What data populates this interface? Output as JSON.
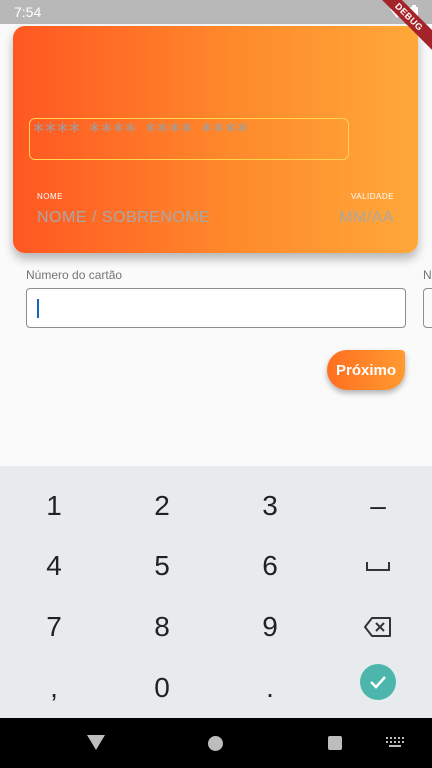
{
  "status_bar": {
    "time": "7:54",
    "debug_label": "DEBUG"
  },
  "card": {
    "number_placeholder": "**** **** **** ****",
    "name_caption": "NOME",
    "name_placeholder": "NOME / SOBRENOME",
    "validity_caption": "VALIDADE",
    "validity_placeholder": "MM/AA",
    "colors": {
      "gradient_start": "#ff5722",
      "gradient_end": "#ffa83a",
      "number_border": "#ffd54f"
    }
  },
  "form": {
    "card_number_label": "Número do cartão",
    "card_number_value": "",
    "next_field_label": "N",
    "next_button_label": "Próximo"
  },
  "keyboard": {
    "rows": [
      [
        "1",
        "2",
        "3",
        "–"
      ],
      [
        "4",
        "5",
        "6",
        "space-icon"
      ],
      [
        "7",
        "8",
        "9",
        "backspace-icon"
      ],
      [
        ",",
        "0",
        ".",
        "done-icon"
      ]
    ],
    "done_color": "#4db6ac"
  },
  "nav_bar": {
    "icons": [
      "back-icon",
      "home-icon",
      "recents-icon",
      "keyboard-switch-icon"
    ]
  }
}
